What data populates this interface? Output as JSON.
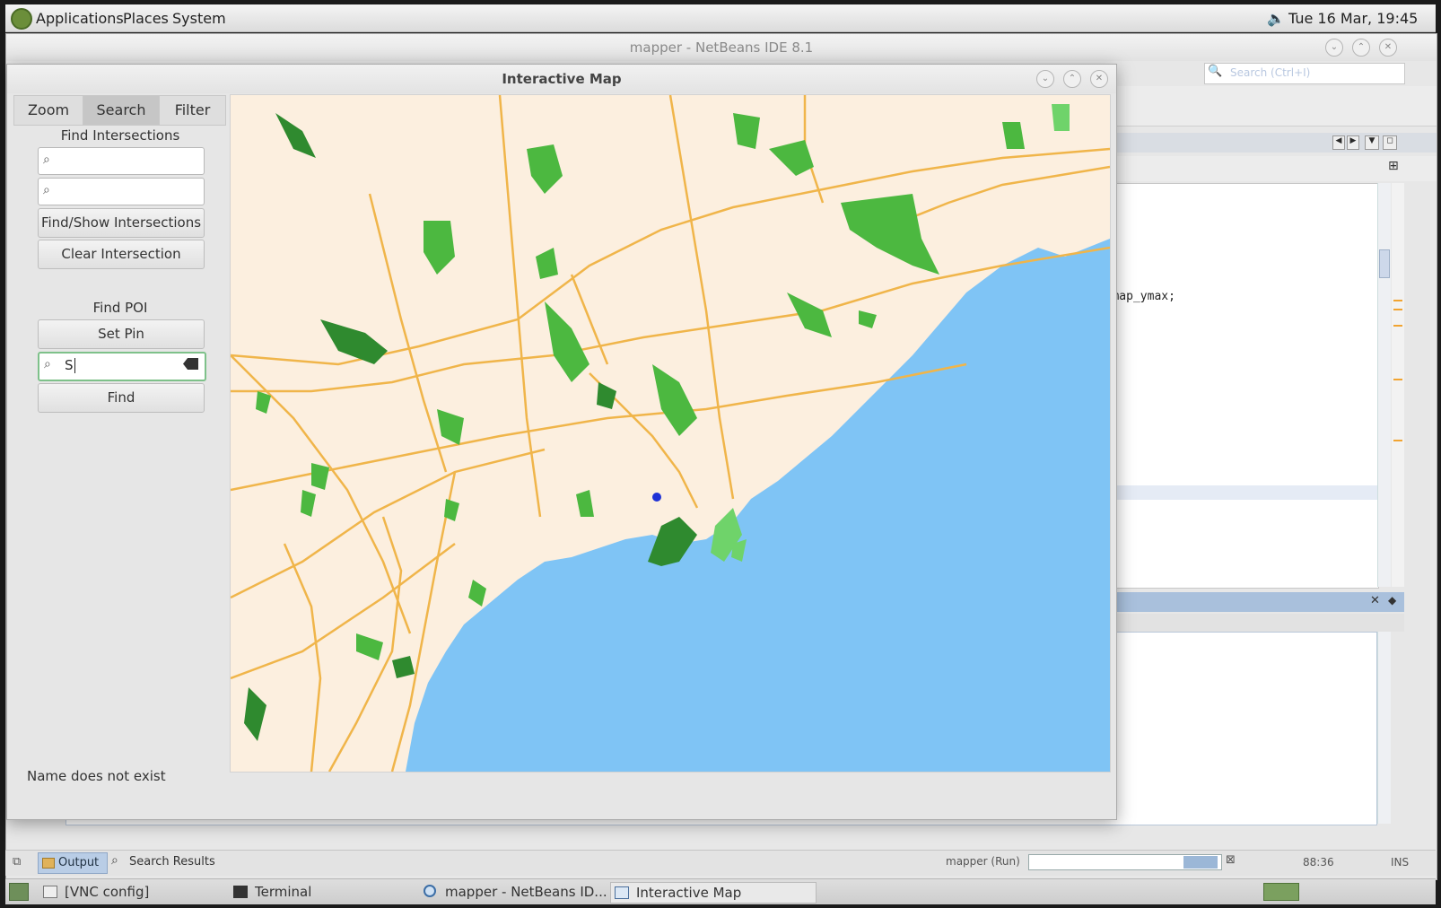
{
  "top_panel": {
    "menus": [
      "Applications",
      "Places",
      "System"
    ],
    "clock": "Tue 16 Mar, 19:45"
  },
  "ide": {
    "title": "mapper - NetBeans IDE 8.1",
    "search_placeholder": "Search (Ctrl+I)",
    "code_fragment": "n, map_ymax;",
    "status": {
      "output_tab": "Output",
      "search_results_tab": "Search Results",
      "run_label": "mapper (Run)",
      "position": "88:36",
      "mode": "INS"
    }
  },
  "dialog": {
    "title": "Interactive Map",
    "tabs": [
      {
        "label": "Zoom",
        "active": false
      },
      {
        "label": "Search",
        "active": true
      },
      {
        "label": "Filter",
        "active": false
      }
    ],
    "find_intersections": {
      "heading": "Find Intersections",
      "street1": "",
      "street2": "",
      "find_button": "Find/Show Intersections",
      "clear_button": "Clear Intersection"
    },
    "find_poi": {
      "heading": "Find POI",
      "set_pin_button": "Set Pin",
      "query": "S",
      "find_button": "Find"
    },
    "status_message": "Name does not exist"
  },
  "map": {
    "land_color": "#fcefdf",
    "water_color": "#7fc4f5",
    "road_color": "#f0b54a",
    "park_colors": [
      "#4cb840",
      "#2f8a2f",
      "#6fd36a"
    ],
    "pin_color": "#1f32d6"
  },
  "taskbar": {
    "items": [
      "[VNC config]",
      "Terminal",
      "mapper - NetBeans ID...",
      "Interactive Map"
    ]
  }
}
